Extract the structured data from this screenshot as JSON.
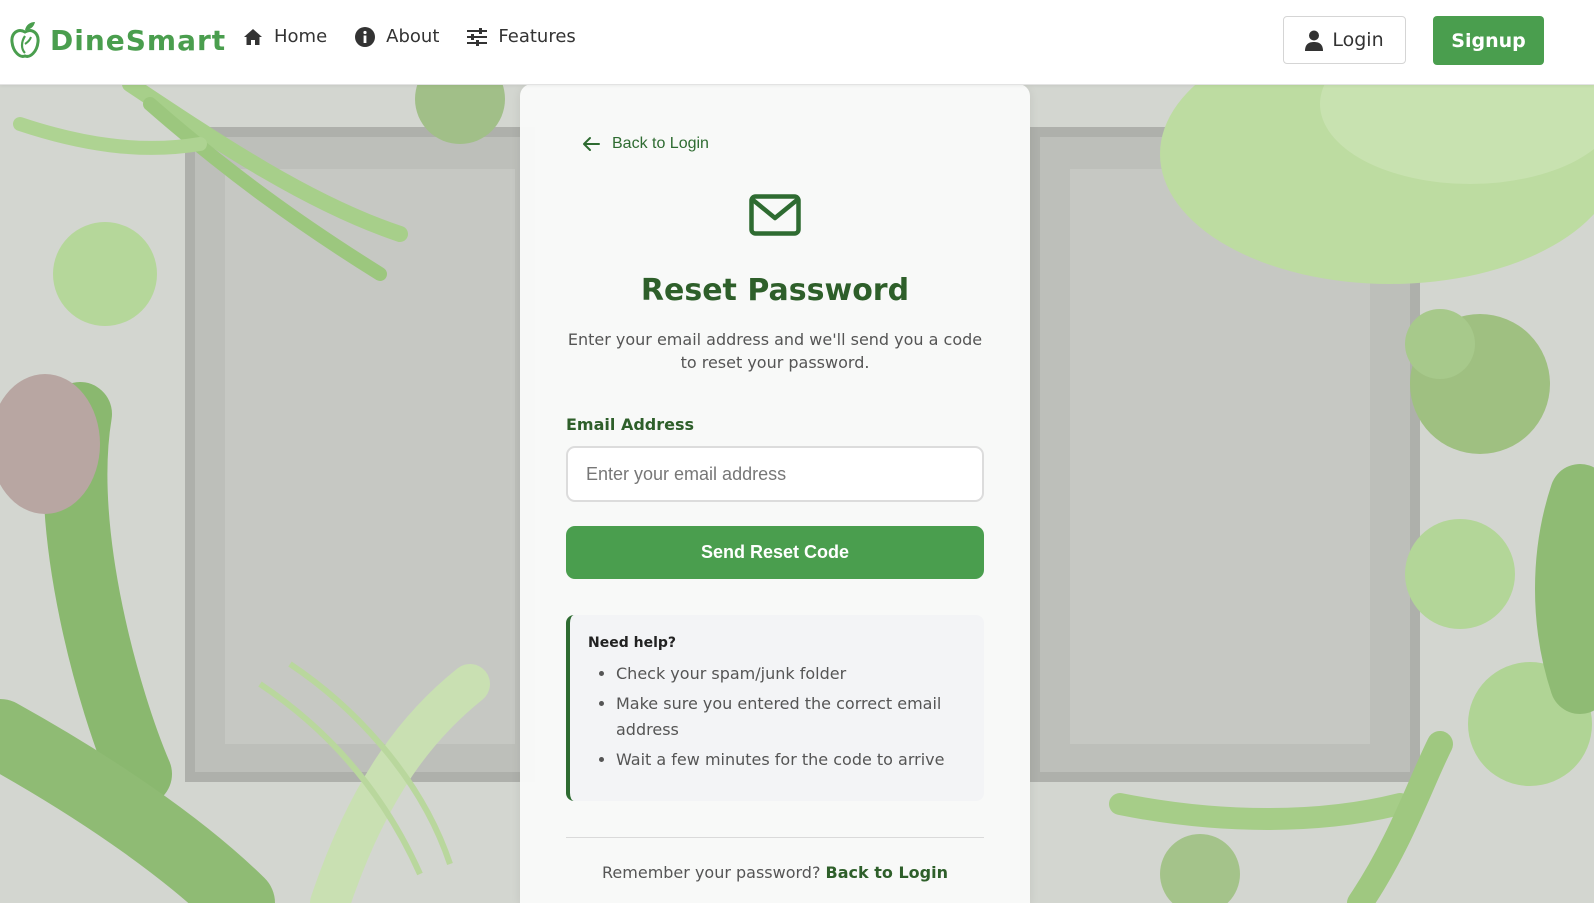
{
  "brand": {
    "name": "DineSmart",
    "icon": "apple-leaf-logo-icon",
    "color": "#4a9e4e"
  },
  "nav": {
    "links": [
      {
        "label": "Home",
        "icon": "home-icon"
      },
      {
        "label": "About",
        "icon": "info-circle-icon"
      },
      {
        "label": "Features",
        "icon": "sliders-icon"
      }
    ],
    "login_label": "Login",
    "login_icon": "user-icon",
    "signup_label": "Signup"
  },
  "card": {
    "back_label": "Back to Login",
    "mail_icon": "envelope-icon",
    "title": "Reset Password",
    "subtitle": "Enter your email address and we'll send you a code to reset your password.",
    "email_label": "Email Address",
    "email_placeholder": "Enter your email address",
    "email_value": "",
    "submit_label": "Send Reset Code",
    "help": {
      "title": "Need help?",
      "items": [
        "Check your spam/junk folder",
        "Make sure you entered the correct email address",
        "Wait a few minutes for the code to arrive"
      ]
    },
    "footer_text": "Remember your password?",
    "footer_link": "Back to Login"
  },
  "colors": {
    "primary": "#4a9e4e",
    "dark_green": "#2e5f2a",
    "accent_border": "#2e6b31"
  }
}
